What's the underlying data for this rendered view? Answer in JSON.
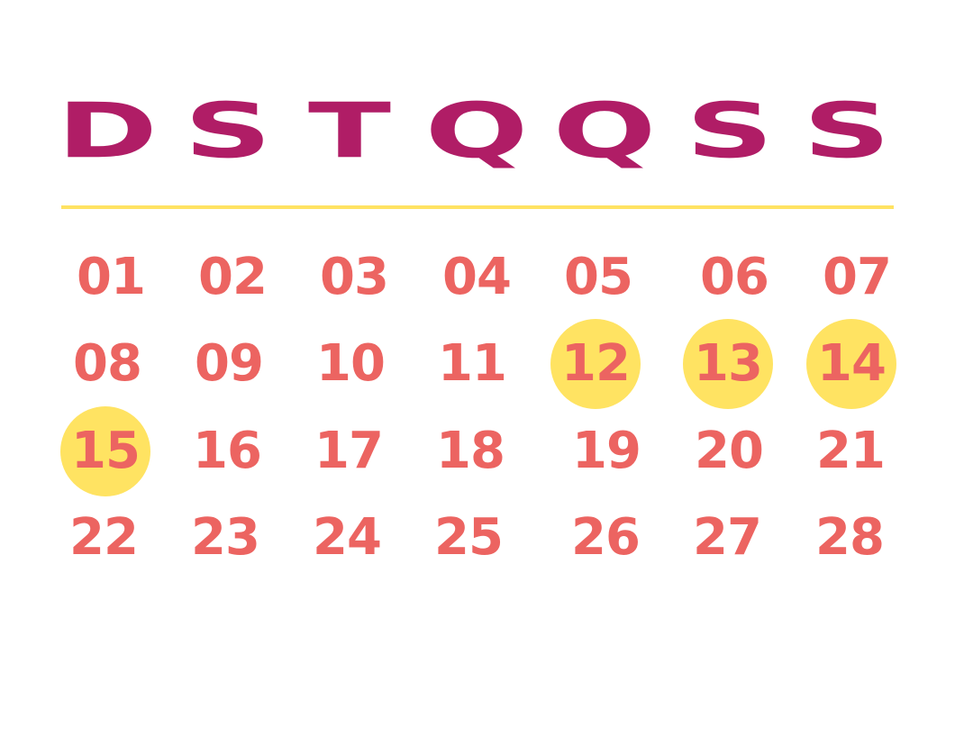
{
  "calendar": {
    "weekdays": [
      "D",
      "S",
      "T",
      "Q",
      "Q",
      "S",
      "S"
    ],
    "weeks": [
      [
        "01",
        "02",
        "03",
        "04",
        "05",
        "06",
        "07"
      ],
      [
        "08",
        "09",
        "10",
        "11",
        "12",
        "13",
        "14"
      ],
      [
        "15",
        "16",
        "17",
        "18",
        "19",
        "20",
        "21"
      ],
      [
        "22",
        "23",
        "24",
        "25",
        "26",
        "27",
        "28"
      ]
    ],
    "highlighted_days": [
      "12",
      "13",
      "14",
      "15"
    ]
  },
  "colors": {
    "weekday_text": "#b01d66",
    "day_text": "#ec6461",
    "highlight": "#ffe362",
    "divider": "#ffe362",
    "background": "#ffffff"
  }
}
